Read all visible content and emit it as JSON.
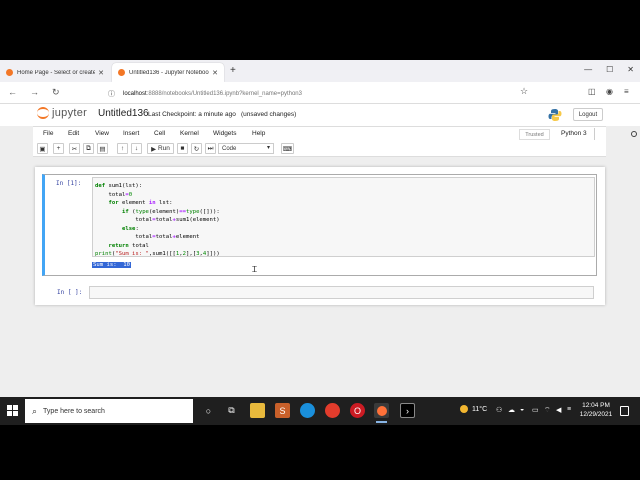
{
  "browser": {
    "tabs": [
      {
        "title": "Home Page - Select or create a",
        "close": "✕"
      },
      {
        "title": "Untitled136 - Jupyter Notebook",
        "close": "✕"
      }
    ],
    "new_tab": "+",
    "window_controls": {
      "minimize": "—",
      "maximize": "☐",
      "close": "✕"
    },
    "nav": {
      "back": "←",
      "forward": "→",
      "reload": "↻"
    },
    "url": {
      "host": "localhost",
      "rest": ":8888/notebooks/Untitled136.ipynb?kernel_name=python3"
    },
    "bookmark_star": "☆"
  },
  "jupyter": {
    "logo_text": "jupyter",
    "notebook_name": "Untitled136",
    "checkpoint": "Last Checkpoint: a minute ago",
    "status": "(unsaved changes)",
    "logout": "Logout",
    "menus": [
      "File",
      "Edit",
      "View",
      "Insert",
      "Cell",
      "Kernel",
      "Widgets",
      "Help"
    ],
    "trusted": "Trusted",
    "kernel": "Python 3",
    "toolbar": {
      "run_label": "Run",
      "cell_type": "Code"
    }
  },
  "cells": [
    {
      "prompt": "In [1]:",
      "output": "Sum is:  10"
    },
    {
      "prompt": "In [ ]:"
    }
  ],
  "taskbar": {
    "search_placeholder": "Type here to search",
    "weather": "11°C",
    "time": "12:04 PM",
    "date": "12/29/2021"
  }
}
